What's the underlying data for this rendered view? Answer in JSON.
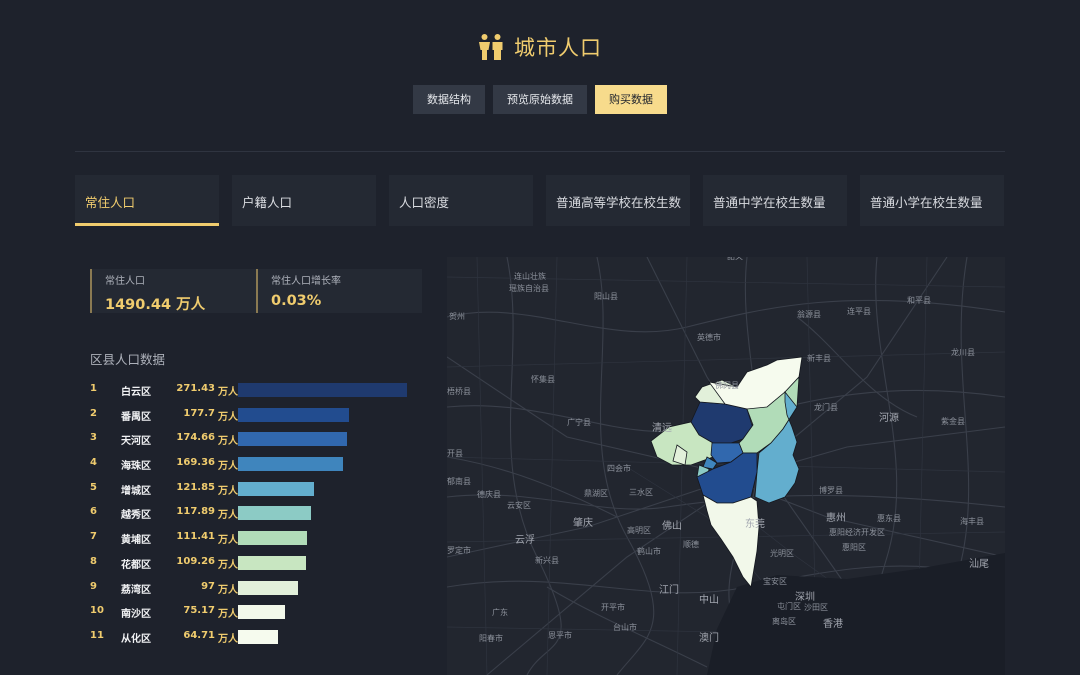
{
  "header": {
    "title": "城市人口"
  },
  "buttons": {
    "structure": "数据结构",
    "preview": "预览原始数据",
    "buy": "购买数据"
  },
  "tabs": [
    "常住人口",
    "户籍人口",
    "人口密度",
    "普通高等学校在校生数",
    "普通中学在校生数量",
    "普通小学在校生数量"
  ],
  "stats": {
    "resident_label": "常住人口",
    "resident_value": "1490.44 万人",
    "growth_label": "常住人口增长率",
    "growth_value": "0.03%"
  },
  "ranking": {
    "title": "区县人口数据",
    "unit": "万人",
    "rows": [
      {
        "rank": "1",
        "name": "白云区",
        "value": 271.43,
        "display": "271.43",
        "color": "#1f3a6f"
      },
      {
        "rank": "2",
        "name": "番禺区",
        "value": 177.7,
        "display": "177.7",
        "color": "#224c8f"
      },
      {
        "rank": "3",
        "name": "天河区",
        "value": 174.66,
        "display": "174.66",
        "color": "#3168ae"
      },
      {
        "rank": "4",
        "name": "海珠区",
        "value": 169.36,
        "display": "169.36",
        "color": "#3f85bd"
      },
      {
        "rank": "5",
        "name": "增城区",
        "value": 121.85,
        "display": "121.85",
        "color": "#63aece"
      },
      {
        "rank": "6",
        "name": "越秀区",
        "value": 117.89,
        "display": "117.89",
        "color": "#8ccbc5"
      },
      {
        "rank": "7",
        "name": "黄埔区",
        "value": 111.41,
        "display": "111.41",
        "color": "#b1dcb8"
      },
      {
        "rank": "8",
        "name": "花都区",
        "value": 109.26,
        "display": "109.26",
        "color": "#c8e6c1"
      },
      {
        "rank": "9",
        "name": "荔湾区",
        "value": 97,
        "display": "97",
        "color": "#e2f0da"
      },
      {
        "rank": "10",
        "name": "南沙区",
        "value": 75.17,
        "display": "75.17",
        "color": "#f2f8ea"
      },
      {
        "rank": "11",
        "name": "从化区",
        "value": 64.71,
        "display": "64.71",
        "color": "#f6fbee"
      }
    ]
  },
  "map": {
    "labels": [
      "韶关",
      "连山壮族",
      "瑶族自治县",
      "阳山县",
      "翁源县",
      "连平县",
      "和平县",
      "贺州",
      "英德市",
      "新丰县",
      "龙川县",
      "怀集县",
      "佛冈县",
      "龙门县",
      "河源",
      "紫金县",
      "广宁县",
      "清远",
      "四会市",
      "开县",
      "鼎湖区",
      "三水区",
      "博罗县",
      "惠州",
      "惠东县",
      "海丰县",
      "德庆县",
      "云安区",
      "肇庆",
      "高明区",
      "佛山",
      "东莞",
      "惠阳经济开发区",
      "惠阳区",
      "云浮",
      "鹤山市",
      "顺德",
      "光明区",
      "汕尾",
      "罗定市",
      "新兴县",
      "江门",
      "宝安区",
      "深圳",
      "屯门区",
      "沙田区",
      "中山",
      "离岛区",
      "香港",
      "开平市",
      "台山市",
      "澳门",
      "阳春市",
      "恩平市",
      "梧桥县",
      "郁南县",
      "广东"
    ]
  }
}
